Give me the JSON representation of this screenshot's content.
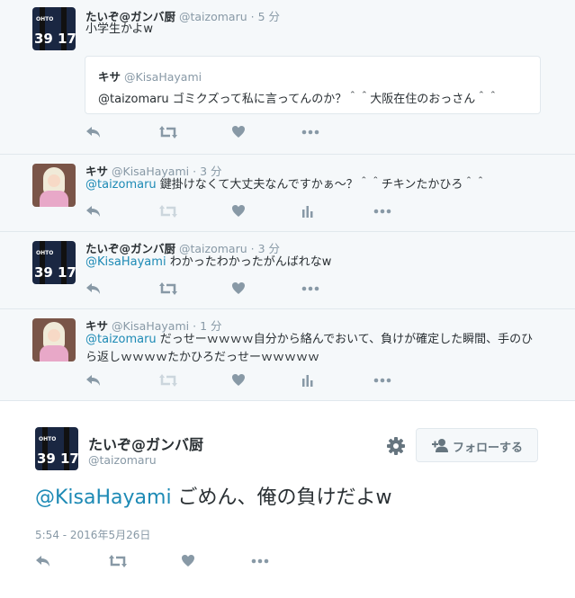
{
  "conversation": [
    {
      "name": "たいぞ@ガンバ厨",
      "handle": "@taizomaru",
      "time": "5 分",
      "text": "小学生かよw",
      "avatar": "gamba-jersey-avatar",
      "quote": {
        "name": "キサ",
        "handle": "@KisaHayami",
        "text": "@taizomaru ゴミクズって私に言ってんのか？＾＾大阪在住のおっさん＾＾"
      }
    },
    {
      "name": "キサ",
      "handle": "@KisaHayami",
      "time": "3 分",
      "mention": "@taizomaru",
      "text": " 鍵掛けなくて大丈夫なんですかぁ〜？＾＾チキンたかひろ＾＾",
      "avatar": "anime-girl-avatar"
    },
    {
      "name": "たいぞ@ガンバ厨",
      "handle": "@taizomaru",
      "time": "3 分",
      "mention": "@KisaHayami",
      "text": " わかったわかったがんばれなw",
      "avatar": "gamba-jersey-avatar"
    },
    {
      "name": "キサ",
      "handle": "@KisaHayami",
      "time": "1 分",
      "mention": "@taizomaru",
      "text": " だっせーｗｗｗｗ自分から絡んでおいて、負けが確定した瞬間、手のひら返しｗｗｗｗたかひろだっせーｗｗｗｗｗ",
      "avatar": "anime-girl-avatar"
    }
  ],
  "main_tweet": {
    "name": "たいぞ@ガンバ厨",
    "handle": "@taizomaru",
    "mention": "@KisaHayami",
    "text": " ごめん、俺の負けだよw",
    "timestamp": "5:54 - 2016年5月26日",
    "follow_label": "フォローする"
  },
  "avatar_art": {
    "sponsor": "OHTO",
    "number_left": "39",
    "number_right": "17"
  },
  "icons": [
    "reply-icon",
    "retweet-icon",
    "like-icon",
    "analytics-icon",
    "more-icon",
    "gear-icon",
    "follow-icon"
  ],
  "colors": {
    "mention": "#1d8ab5",
    "meta": "#8899a6",
    "icon": "#8899a6",
    "icon_disabled": "#ccd6dd",
    "background": "#f5f8fa",
    "border": "#e1e8ed"
  },
  "separator": "·"
}
